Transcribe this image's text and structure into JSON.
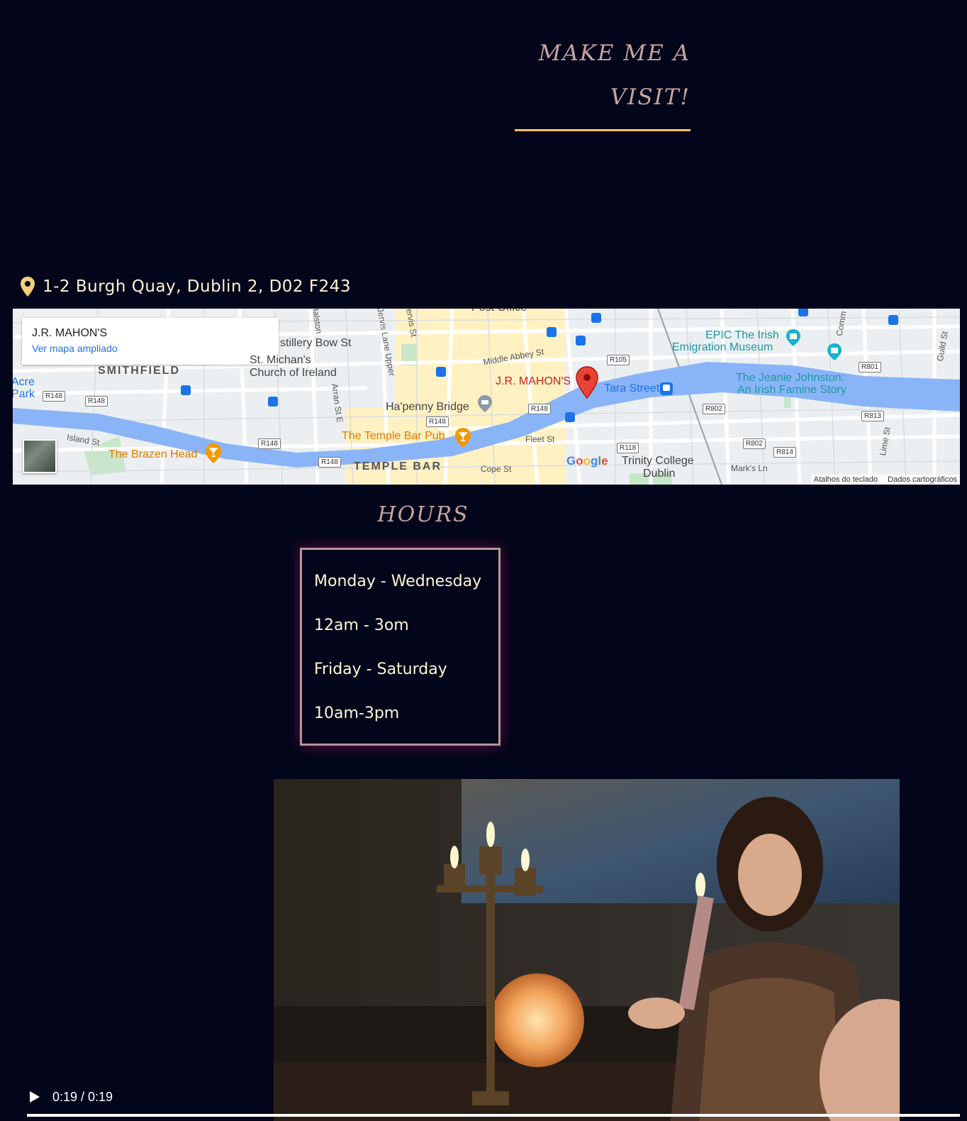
{
  "visit": {
    "heading_line1": "MAKE ME A",
    "heading_line2": "VISIT!",
    "address": "1-2 Burgh Quay, Dublin 2, D02 F243",
    "address_icon": "map-pin-icon"
  },
  "map": {
    "card_title": "J.R. MAHON'S",
    "card_link": "Ver mapa ampliado",
    "marker_label": "J.R. MAHON'S",
    "areas": [
      "SMITHFIELD",
      "TEMPLE BAR"
    ],
    "places": {
      "distillery": "stillery Bow St",
      "church_1": "St. Michan's",
      "church_2": "Church of Ireland",
      "bridge": "Ha'penny Bridge",
      "temple_bar_pub": "The Temple Bar Pub",
      "brazen_head": "The Brazen Head",
      "tara_street": "Tara Street",
      "epic_1": "EPIC The Irish",
      "epic_2": "Emigration Museum",
      "jeanie_1": "The Jeanie Johnston:",
      "jeanie_2": "An Irish Famine Story",
      "trinity_1": "Trinity College",
      "trinity_2": "Dublin",
      "acre": "Acre",
      "park": "Park",
      "post_office": "Post Office"
    },
    "streets": {
      "middle_abbey": "Middle Abbey St",
      "jervis_upper": "Jervis Lane Upper",
      "jervis": "Jervis St",
      "arran": "Arran St E",
      "island": "Island St",
      "fleet": "Fleet St",
      "cope": "Cope St",
      "marks": "Mark's Ln",
      "lime": "Lime St",
      "guild": "Guild St",
      "halston": "Halston",
      "comm": "Comm"
    },
    "routes": {
      "r105": "R105",
      "r148": "R148",
      "r801": "R801",
      "r802": "R802",
      "r813": "R813",
      "r814": "R814",
      "r118": "R118"
    },
    "google": "Google",
    "footer_shortcuts": "Atalhos do teclado",
    "footer_data": "Dados cartográficos",
    "colors": {
      "water": "#8ab4f8",
      "park": "#c8e6c9",
      "roads": "#ffffff",
      "tourist": "#fff1c1"
    }
  },
  "hours": {
    "heading": "HOURS",
    "lines": [
      "Monday - Wednesday",
      "12am - 3om",
      "Friday - Saturday",
      "10am-3pm"
    ]
  },
  "video": {
    "time": "0:19 / 0:19",
    "progress": 1.0,
    "play_icon": "play-icon"
  },
  "colors": {
    "background": "#03061a",
    "heading": "#c9a2a0",
    "accent_underline": "#f2c46a",
    "text_cream": "#fff4d6",
    "box_border": "#b8949a"
  }
}
